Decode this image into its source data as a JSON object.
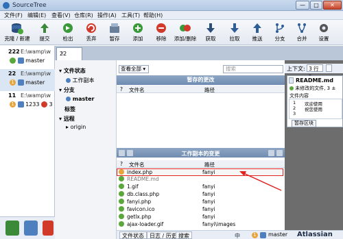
{
  "window": {
    "title": "SourceTree",
    "min": "—",
    "max": "□",
    "close": "✕"
  },
  "menu": [
    "文件(F)",
    "编辑(E)",
    "查看(V)",
    "仓库(R)",
    "操作(A)",
    "工具(T)",
    "帮助(H)"
  ],
  "toolbar": {
    "items": [
      {
        "label": "克隆 / 新建",
        "icon": "clone-icon"
      },
      {
        "label": "提交",
        "icon": "commit-icon"
      },
      {
        "label": "检出",
        "icon": "checkout-icon"
      },
      {
        "label": "丢弃",
        "icon": "discard-icon"
      },
      {
        "label": "暂存",
        "icon": "stash-icon"
      },
      {
        "label": "添加",
        "icon": "add-icon"
      },
      {
        "label": "移除",
        "icon": "remove-icon"
      },
      {
        "label": "添加/删除",
        "icon": "add-remove-icon"
      },
      {
        "label": "获取",
        "icon": "fetch-icon"
      },
      {
        "label": "拉取",
        "icon": "pull-icon"
      },
      {
        "label": "推送",
        "icon": "push-icon"
      },
      {
        "label": "分支",
        "icon": "branch-icon"
      },
      {
        "label": "合并",
        "icon": "merge-icon"
      },
      {
        "label": "设置",
        "icon": "settings-icon"
      }
    ]
  },
  "repos": [
    {
      "num": "222",
      "path": "E:\\wamp\\w",
      "branch": "master"
    },
    {
      "num": "22",
      "path": "E:\\wamp\\w",
      "badge": "1",
      "branch": "master"
    },
    {
      "num": "11",
      "path": "E:\\wamp\\w",
      "badge": "1",
      "branch": "1233",
      "count": "3"
    }
  ],
  "tab": {
    "label": "22"
  },
  "sidebar": {
    "file_status": "文件状态",
    "working_copy": "工作副本",
    "branches": "分支",
    "master": "master",
    "tags": "标签",
    "remotes": "远程",
    "origin": "origin"
  },
  "center": {
    "view_select": "查看全部",
    "search_placeholder": "搜索",
    "staged_header": "暂存的更改",
    "unstaged_header": "工作副本的变更",
    "col_q": "?",
    "col_file": "文件名",
    "col_path": "路径",
    "files": [
      {
        "name": "index.php",
        "path": "fanyi",
        "status": "modified"
      },
      {
        "name": "README.md",
        "path": "",
        "status": "added"
      },
      {
        "name": "1.gif",
        "path": "fanyi",
        "status": "added"
      },
      {
        "name": "db.class.php",
        "path": "fanyi",
        "status": "added"
      },
      {
        "name": "fanyi.php",
        "path": "fanyi",
        "status": "added"
      },
      {
        "name": "favicon.ico",
        "path": "fanyi",
        "status": "added"
      },
      {
        "name": "getlx.php",
        "path": "fanyi",
        "status": "added"
      },
      {
        "name": "ajax-loader.gif",
        "path": "fanyi\\images",
        "status": "added"
      }
    ]
  },
  "right": {
    "context_label": "上下文:",
    "context_value": "3 行",
    "file_name": "README.md",
    "file_note": "未修改的文件, 3 ±",
    "content_label": "文件内容",
    "lines": [
      {
        "n": "1",
        "t": "欢迎使用"
      },
      {
        "n": "2",
        "t": "祝您使用"
      },
      {
        "n": "3",
        "t": ""
      }
    ],
    "stage_button": "暂存区块"
  },
  "statusbar": {
    "tabs": [
      "文件状态",
      "日志 / 历史",
      "搜索"
    ],
    "badge": "1",
    "branch": "master",
    "brand": "Atlassian",
    "ime": "中"
  },
  "colors": {
    "modified": "#e8a33a",
    "added": "#5aa83b",
    "accent": "#2f6fb8",
    "annotation": "#e0211e"
  }
}
